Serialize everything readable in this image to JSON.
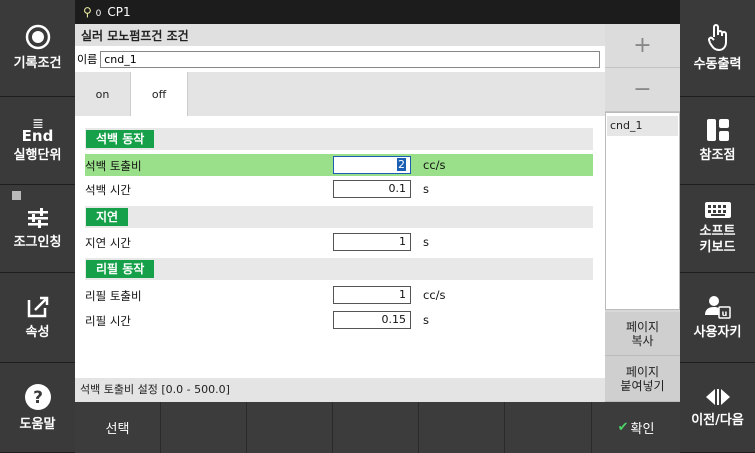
{
  "status": {
    "robot_label": "0",
    "cpu": "CP1"
  },
  "left_sidebar": [
    {
      "label": "기록조건",
      "icon": "record-circle-icon"
    },
    {
      "label": "실행단위",
      "icon": "end-list-icon",
      "icon_text": "End"
    },
    {
      "label": "조그인칭",
      "icon": "sliders-icon"
    },
    {
      "label": "속성",
      "icon": "edit-icon"
    },
    {
      "label": "도움말",
      "icon": "help-icon"
    }
  ],
  "right_sidebar": [
    {
      "label": "수동출력",
      "icon": "hand-pointer-icon"
    },
    {
      "label": "참조점",
      "icon": "layout-icon"
    },
    {
      "label": "소프트\n키보드",
      "icon": "keyboard-icon"
    },
    {
      "label": "사용자키",
      "icon": "user-key-icon"
    },
    {
      "label": "이전/다음",
      "icon": "prev-next-icon"
    }
  ],
  "panel": {
    "title": "실러 모노펌프건 조건",
    "name_label": "이름",
    "name_value": "cnd_1",
    "tabs": [
      {
        "label": "on"
      },
      {
        "label": "off"
      }
    ],
    "sections": [
      {
        "title": "석백 동작",
        "rows": [
          {
            "label": "석백 토출비",
            "value": "2",
            "unit": "cc/s",
            "selected": true
          },
          {
            "label": "석백 시간",
            "value": "0.1",
            "unit": "s"
          }
        ]
      },
      {
        "title": "지연",
        "rows": [
          {
            "label": "지연 시간",
            "value": "1",
            "unit": "s"
          }
        ]
      },
      {
        "title": "리필 동작",
        "rows": [
          {
            "label": "리필 토출비",
            "value": "1",
            "unit": "cc/s"
          },
          {
            "label": "리필 시간",
            "value": "0.15",
            "unit": "s"
          }
        ]
      }
    ],
    "hint": "석백 토출비 설정 [0.0 - 500.0]"
  },
  "mini_panel": {
    "add": "+",
    "remove": "−",
    "items": [
      "cnd_1"
    ],
    "page_copy": "페이지\n복사",
    "page_paste": "페이지\n붙여넣기"
  },
  "bottom_bar": {
    "select": "선택",
    "confirm": "확인"
  },
  "colors": {
    "section_green": "#17a04a",
    "selected_row": "#9ae08a",
    "focus_blue": "#1a5fb4"
  }
}
